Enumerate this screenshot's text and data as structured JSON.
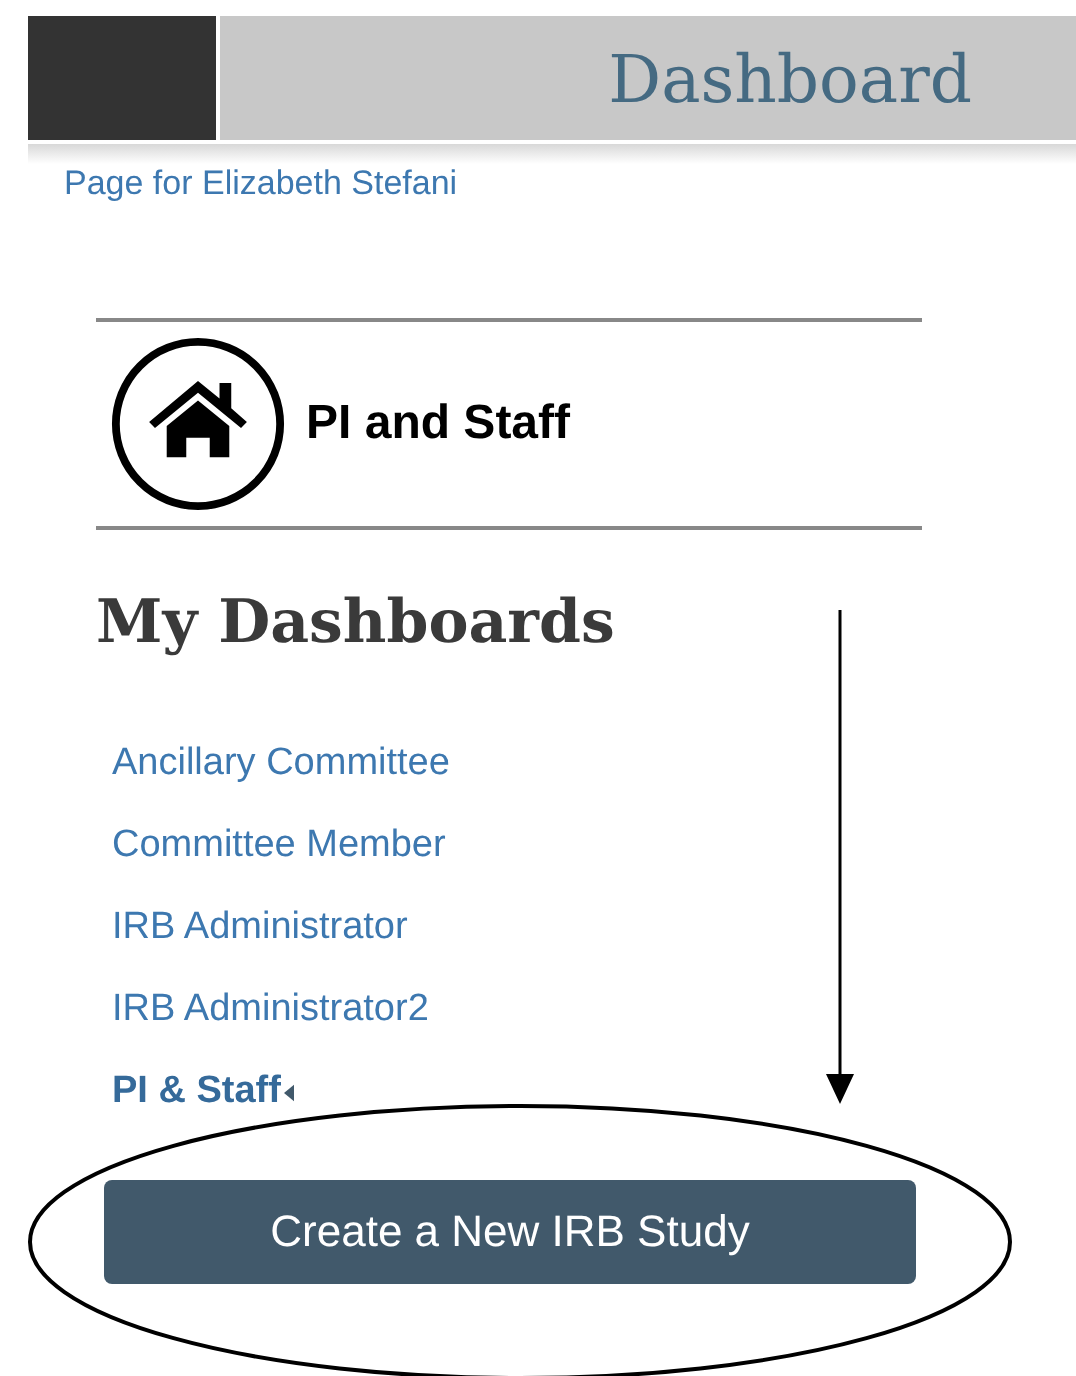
{
  "header": {
    "title": "Dashboard"
  },
  "page_for": "Page for Elizabeth Stefani",
  "role": {
    "label": "PI and Staff"
  },
  "dashboards": {
    "heading": "My Dashboards",
    "items": [
      {
        "label": "Ancillary Committee",
        "selected": false
      },
      {
        "label": "Committee Member",
        "selected": false
      },
      {
        "label": "IRB Administrator",
        "selected": false
      },
      {
        "label": "IRB Administrator2",
        "selected": false
      },
      {
        "label": "PI & Staff",
        "selected": true
      }
    ]
  },
  "action_button": "Create a New IRB Study"
}
